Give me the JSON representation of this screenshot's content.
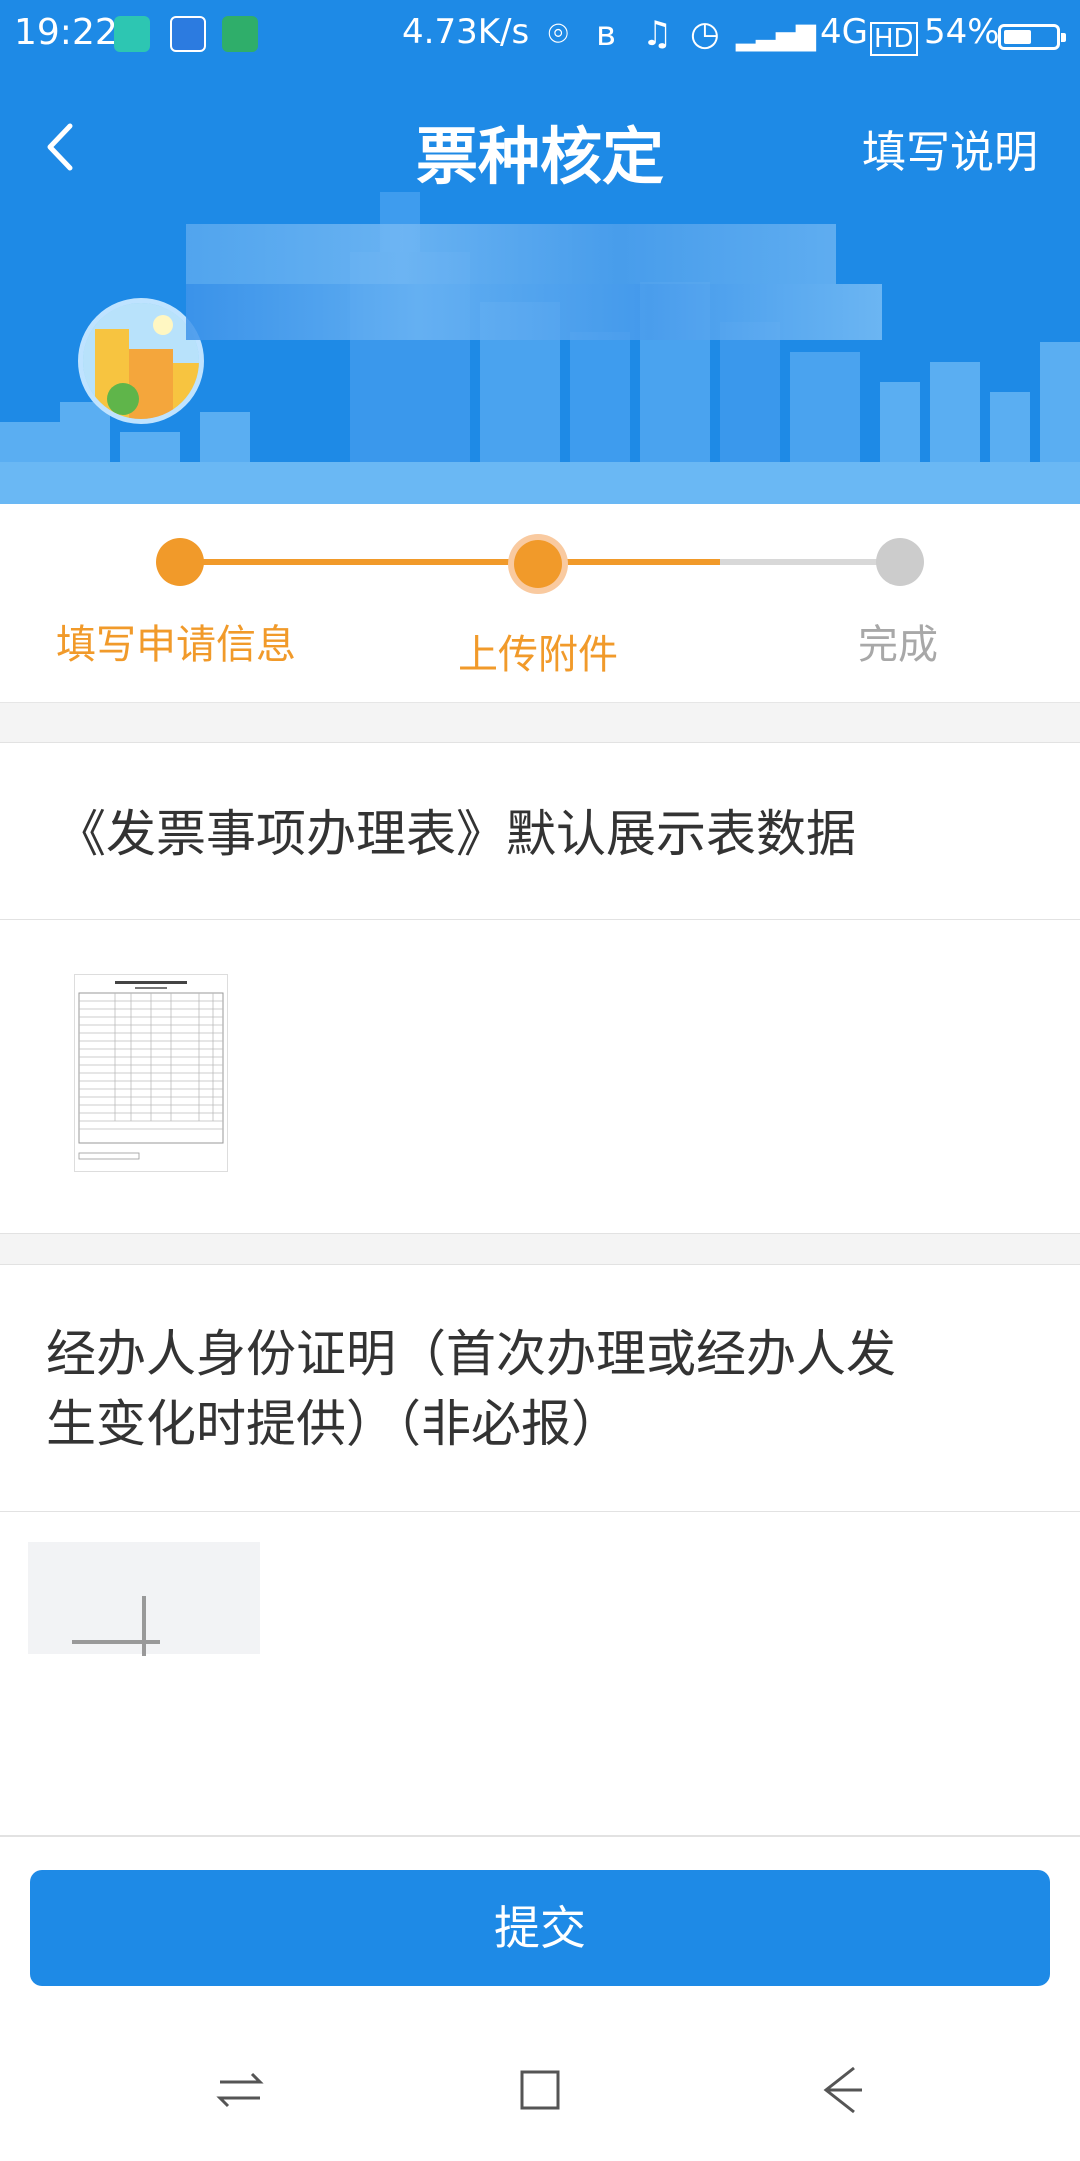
{
  "status_bar": {
    "time": "19:22",
    "network_speed": "4.73K/s",
    "network_type": "4G",
    "battery": "54%",
    "battery_level": 0.54,
    "icons": [
      "screenshot-icon",
      "message-icon",
      "hotspot-icon",
      "location-icon",
      "bluetooth-icon",
      "mute-icon",
      "alarm-icon",
      "signal-icon",
      "hd-icon",
      "battery-icon"
    ]
  },
  "header": {
    "title": "票种核定",
    "help_label": "填写说明",
    "back_icon": "back-chevron-icon"
  },
  "stepper": {
    "steps": [
      {
        "label": "填写申请信息",
        "state": "done"
      },
      {
        "label": "上传附件",
        "state": "current"
      },
      {
        "label": "完成",
        "state": "todo"
      }
    ]
  },
  "sections": [
    {
      "title": "《发票事项办理表》默认展示表数据",
      "has_thumbnail": true
    },
    {
      "title_line1": "经办人身份证明（首次办理或经办人发",
      "title_line2": "生变化时提供）（非必报）",
      "upload_icon": "plus-icon"
    }
  ],
  "footer": {
    "submit_label": "提交"
  },
  "colors": {
    "primary": "#1e8ae6",
    "accent": "#f19a2a",
    "inactive": "#cccccc"
  }
}
